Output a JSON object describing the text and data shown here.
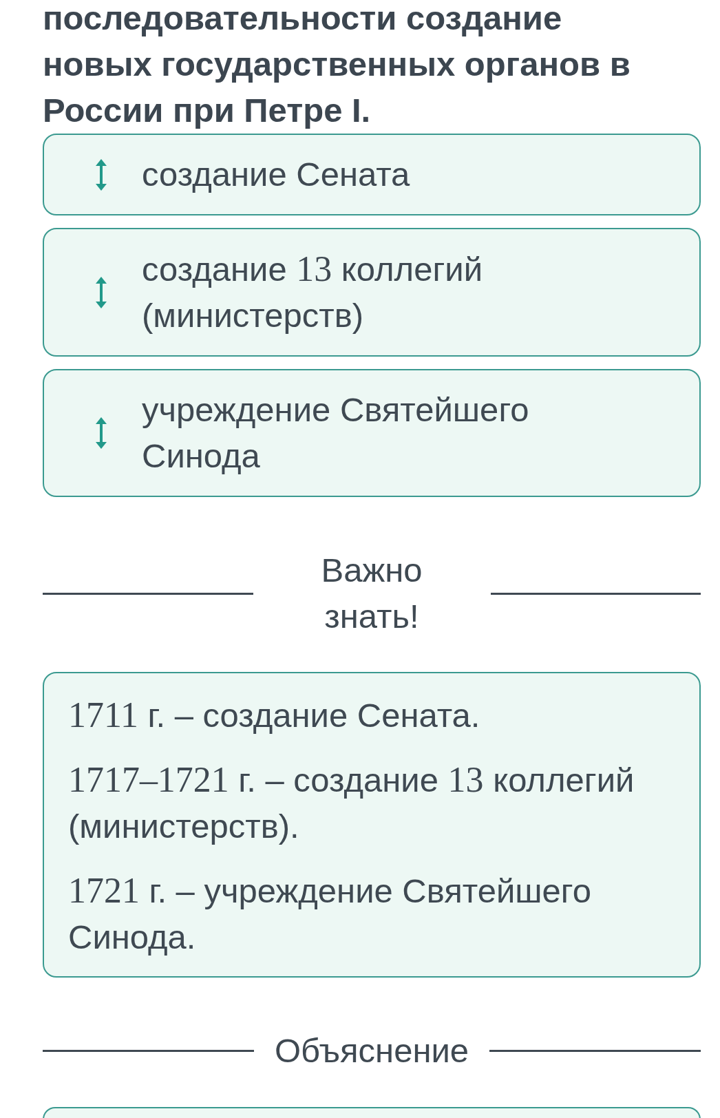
{
  "question": {
    "text": "последовательности создание новых государственных органов в России при Петре I."
  },
  "options": [
    {
      "segments": [
        {
          "kind": "text",
          "text": "создание Сената"
        }
      ]
    },
    {
      "segments": [
        {
          "kind": "text",
          "text": "создание "
        },
        {
          "kind": "math",
          "text": "13"
        },
        {
          "kind": "text",
          "text": " коллегий (министерств)"
        }
      ]
    },
    {
      "segments": [
        {
          "kind": "text",
          "text": "учреждение Святейшего Синода"
        }
      ]
    }
  ],
  "important": {
    "heading": "Важно знать!",
    "facts": [
      {
        "segments": [
          {
            "kind": "math",
            "text": "1711"
          },
          {
            "kind": "text",
            "text": " г. – создание Сената."
          }
        ]
      },
      {
        "segments": [
          {
            "kind": "math",
            "text": "1717–1721"
          },
          {
            "kind": "text",
            "text": " г. – создание "
          },
          {
            "kind": "math",
            "text": "13"
          },
          {
            "kind": "text",
            "text": " коллегий (министерств)."
          }
        ]
      },
      {
        "segments": [
          {
            "kind": "math",
            "text": "1721"
          },
          {
            "kind": "text",
            "text": " г. – учреждение Святейшего Синода."
          }
        ]
      }
    ]
  },
  "explanation": {
    "heading": "Объяснение"
  }
}
